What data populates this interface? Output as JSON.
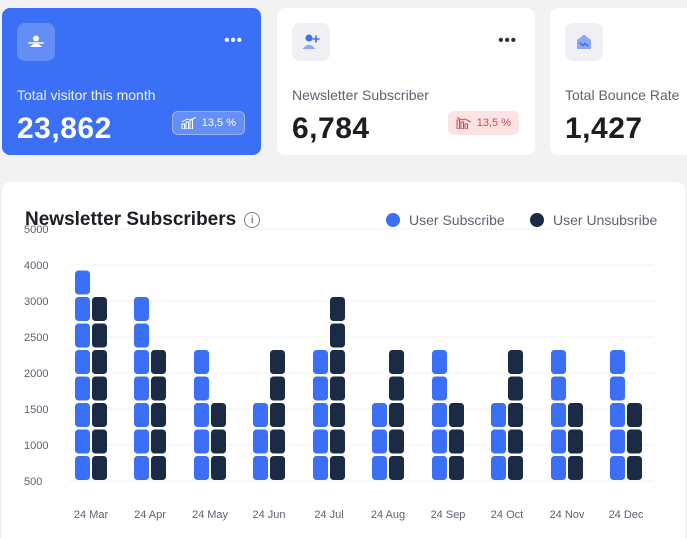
{
  "cards": [
    {
      "label": "Total visitor this month",
      "value": "23,862",
      "badge": "13,5 %",
      "trend": "up",
      "icon": "people-icon",
      "menu": "•••"
    },
    {
      "label": "Newsletter Subscriber",
      "value": "6,784",
      "badge": "13,5 %",
      "trend": "down",
      "icon": "add-user-icon",
      "menu": "•••"
    },
    {
      "label": "Total Bounce Rate",
      "value": "1,427",
      "icon": "bounce-icon"
    }
  ],
  "colors": {
    "accent": "#3b6ff5",
    "subscribe": "#3b6ff5",
    "unsubscribe": "#1b2a45",
    "danger": "#e04545"
  },
  "chart": {
    "title": "Newsletter Subscribers",
    "info_icon": "i",
    "legend": [
      "User Subscribe",
      "User Unsubsribe"
    ]
  },
  "chart_data": {
    "type": "bar",
    "title": "Newsletter Subscribers",
    "categories": [
      "24 Mar",
      "24 Apr",
      "24 May",
      "24 Jun",
      "24 Jul",
      "24 Aug",
      "24 Sep",
      "24 Oct",
      "24 Nov",
      "24 Dec"
    ],
    "series": [
      {
        "name": "User Subscribe",
        "values": [
          4000,
          3250,
          2500,
          1750,
          2500,
          1750,
          2500,
          1750,
          2500,
          2500
        ]
      },
      {
        "name": "User Unsubsribe",
        "values": [
          3250,
          2500,
          1750,
          2500,
          3250,
          2500,
          1500,
          2500,
          1750,
          1500
        ]
      }
    ],
    "y_ticks": [
      "500",
      "1000",
      "1500",
      "2000",
      "2500",
      "3000",
      "4000",
      "5000"
    ],
    "ylim": [
      500,
      5000
    ],
    "grid": true,
    "legend_position": "top-right"
  }
}
